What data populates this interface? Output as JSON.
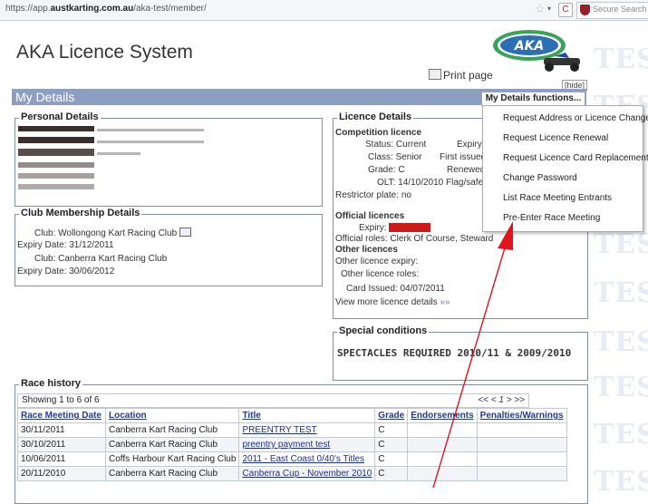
{
  "browser": {
    "url_prefix": "https://app.",
    "url_domain": "austkarting.com.au",
    "url_path": "/aka-test/member/",
    "search_placeholder": "Secure Search"
  },
  "header": {
    "title": "AKA Licence System",
    "print_label": "Print page",
    "hide_label": "[hide]",
    "logo_text": "AKA",
    "logo_sub": "AUSTRALIAN KARTING ASSOC"
  },
  "section_bar": {
    "title": "My Details",
    "functions_button": "My Details functions..."
  },
  "functions_menu": [
    "Request Address or Licence Change",
    "Request Licence Renewal",
    "Request Licence Card Replacement",
    "Change Password",
    "List Race Meeting Entrants",
    "Pre-Enter Race Meeting"
  ],
  "personal_details": {
    "legend": "Personal Details"
  },
  "club_membership": {
    "legend": "Club Membership Details",
    "club1_label": "Club:",
    "club1": "Wollongong Kart Racing Club",
    "expiry1_label": "Expiry Date:",
    "expiry1": "31/12/2011",
    "club2_label": "Club:",
    "club2": "Canberra Kart Racing Club",
    "expiry2_label": "Expiry Date:",
    "expiry2": "30/06/2012"
  },
  "licence_details": {
    "legend": "Licence Details",
    "competition_heading": "Competition licence",
    "status_label": "Status:",
    "status": "Current",
    "expiry_label": "Expiry:",
    "class_label": "Class:",
    "class": "Senior",
    "first_issued_label": "First issued:",
    "grade_label": "Grade:",
    "grade": "C",
    "renewed_label": "Renewed:",
    "olt_label": "OLT:",
    "olt": "14/10/2010",
    "flag_label": "Flag/safety:",
    "restrictor_label": "Restrictor plate:",
    "restrictor": "no",
    "official_heading": "Official licences",
    "official_expiry_label": "Expiry:",
    "official_roles_label": "Official roles:",
    "official_roles": "Clerk Of Course, Steward",
    "other_heading": "Other licences",
    "other_expiry_label": "Other licence expiry:",
    "other_roles_label": "Other licence roles:",
    "card_issued_label": "Card Issued:",
    "card_issued": "04/07/2011",
    "view_more": "View more licence details"
  },
  "special_conditions": {
    "legend": "Special conditions",
    "text": "SPECTACLES REQUIRED 2010/11 & 2009/2010"
  },
  "race_history": {
    "legend": "Race history",
    "showing": "Showing 1 to 6 of 6",
    "pager": "<< < 1 > >>",
    "columns": [
      "Race Meeting Date",
      "Location",
      "Title",
      "Grade",
      "Endorsements",
      "Penalties/Warnings"
    ],
    "rows": [
      [
        "30/11/2011",
        "Canberra Kart Racing Club",
        "PREENTRY TEST",
        "C",
        "",
        ""
      ],
      [
        "30/10/2011",
        "Canberra Kart Racing Club",
        "preentry payment test",
        "C",
        "",
        ""
      ],
      [
        "10/06/2011",
        "Coffs Harbour Kart Racing Club",
        "2011 - East Coast 0/40's Titles",
        "C",
        "",
        ""
      ],
      [
        "20/11/2010",
        "Canberra Kart Racing Club",
        "Canberra Cup - November 2010",
        "C",
        "",
        ""
      ]
    ]
  },
  "watermark": "TES",
  "colors": {
    "bar": "#8d9fc1",
    "arrow": "#e0141c",
    "link": "#1e2f8b",
    "expiry_highlight": "#cc1a1a"
  }
}
